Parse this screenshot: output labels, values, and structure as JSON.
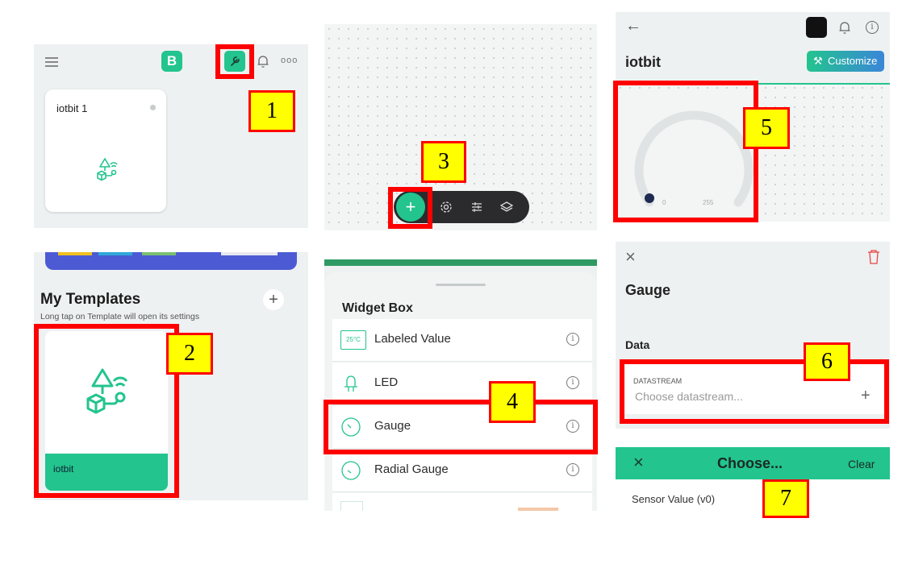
{
  "colors": {
    "accent": "#23c48e",
    "annotation_border": "#ff0000",
    "annotation_fill": "#ffff00",
    "delete_red": "#e84545"
  },
  "panel1": {
    "menu_icon": "hamburger-icon",
    "logo": "B",
    "card_title": "iotbit 1"
  },
  "panel2": {
    "heading": "My Templates",
    "subtitle": "Long tap on Template will open its settings",
    "add_symbol": "+",
    "template_label": "iotbit"
  },
  "panel4": {
    "title": "Widget Box",
    "widgets": [
      {
        "label": "Labeled Value",
        "icon_text": "25°C"
      },
      {
        "label": "LED",
        "icon_text": ""
      },
      {
        "label": "Gauge",
        "icon_text": ""
      },
      {
        "label": "Radial Gauge",
        "icon_text": ""
      }
    ]
  },
  "panel5": {
    "back": "←",
    "title": "iotbit",
    "customize": "Customize",
    "gauge_min": "0",
    "gauge_max": "255",
    "gauge_value": 0
  },
  "panel6": {
    "close": "×",
    "title": "Gauge",
    "section": "Data",
    "field_label": "DATASTREAM",
    "field_placeholder": "Choose datastream...",
    "add": "+"
  },
  "panel7": {
    "close": "×",
    "title": "Choose...",
    "clear": "Clear",
    "option": "Sensor Value (v0)"
  },
  "steps": [
    "1",
    "2",
    "3",
    "4",
    "5",
    "6",
    "7"
  ]
}
